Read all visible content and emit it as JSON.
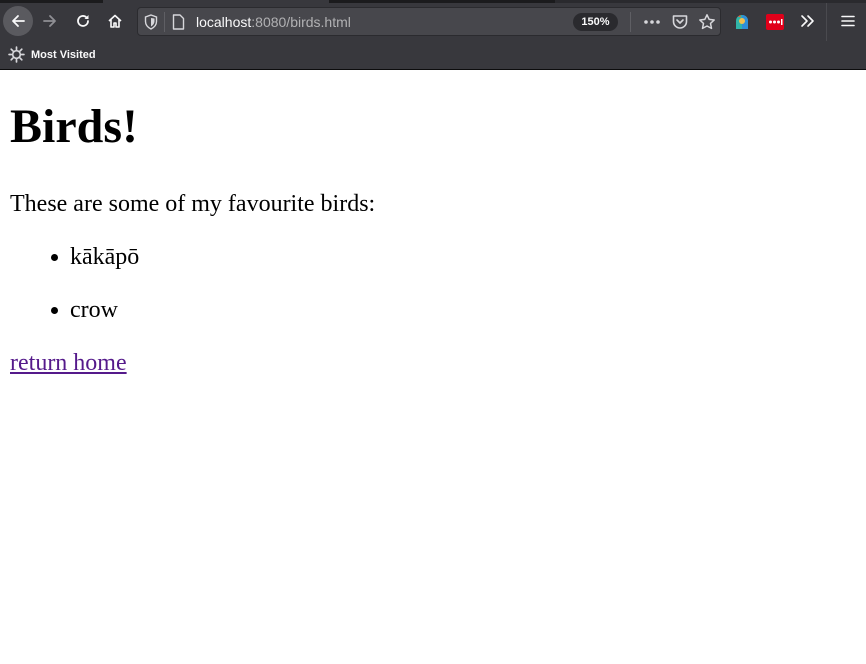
{
  "browser": {
    "url_host": "localhost",
    "url_rest": ":8080/birds.html",
    "zoom": "150%",
    "bookmarks_label": "Most Visited",
    "icons": [
      "back-icon",
      "forward-icon",
      "reload-icon",
      "home-icon",
      "shield-icon",
      "page-icon",
      "more-icon",
      "pocket-icon",
      "star-icon",
      "extension-icon",
      "extension-icon",
      "overflow-icon",
      "menu-icon",
      "gear-icon"
    ]
  },
  "page": {
    "heading": "Birds!",
    "intro": "These are some of my favourite birds:",
    "birds": [
      "kākāpō",
      "crow"
    ],
    "link_text": "return home"
  },
  "colors": {
    "chrome_bg": "#38383d",
    "urlbar_bg": "#47474c",
    "visited_link": "#551a8b"
  }
}
